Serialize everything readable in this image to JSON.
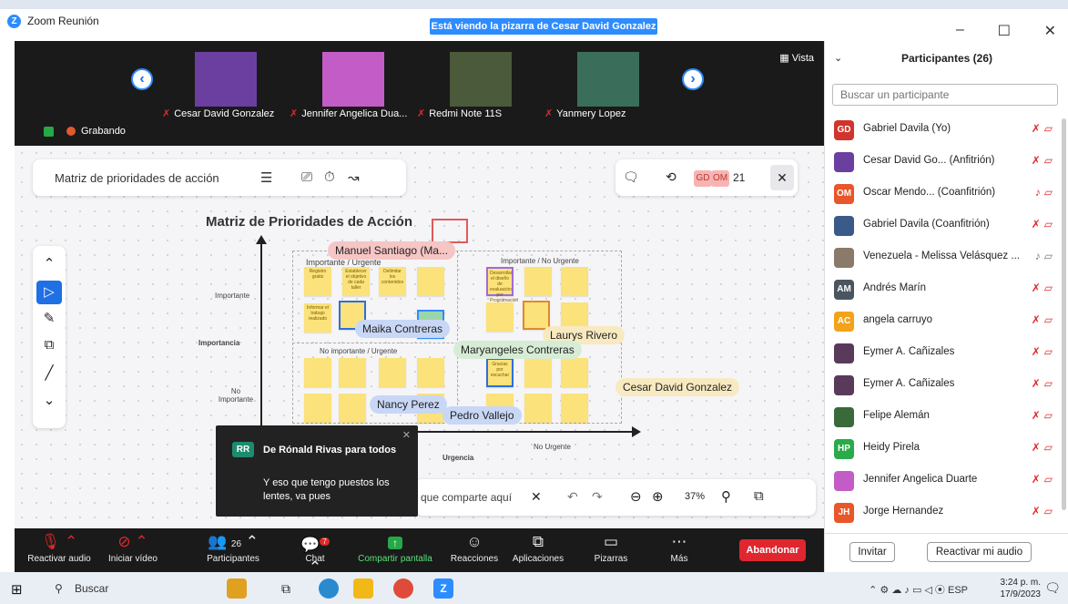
{
  "window": {
    "app_title": "Zoom Reunión",
    "share_banner": "Está viendo la pizarra de Cesar David Gonzalez",
    "view_label": "Vista"
  },
  "videos": [
    {
      "name": "Cesar David Gonzalez",
      "color": "#6b3fa0"
    },
    {
      "name": "Jennifer Angelica Dua...",
      "color": "#c45cc8"
    },
    {
      "name": "Redmi Note 11S",
      "color": "#4a5a3a"
    },
    {
      "name": "Yanmery Lopez",
      "color": "#3a6e5a"
    }
  ],
  "recording_label": "Grabando",
  "whiteboard": {
    "name": "Matriz de prioridades de acción",
    "avatars": [
      "GD",
      "OM"
    ],
    "count": "21",
    "zoom_level": "37%",
    "bottom_text": "que comparte aquí",
    "matrix": {
      "title": "Matriz de Prioridades de Acción",
      "q1": "Importante / Urgente",
      "q2": "Importante / No Urgente",
      "q3": "No importante / Urgente",
      "q4": "No Urgente",
      "y_axis": "Importancia",
      "y_high": "Importante",
      "y_low": "No Importante",
      "x_axis": "Urgencia",
      "notes_q1": [
        "Registro gratis",
        "Establecer el objetivo de cada taller",
        "Delimitar los contenidos",
        "Informar el trabajo realizado"
      ],
      "notes_q2": [
        "Desarrollar el diseño de evaluación por Programación"
      ],
      "notes_q4": [
        "Gracias por escuchar"
      ]
    },
    "cursors": [
      {
        "name": "Manuel Santiago (Ma...",
        "color": "#f6c5c5"
      },
      {
        "name": "Maika Contreras",
        "color": "#c8d7f5"
      },
      {
        "name": "Laurys Rivero",
        "color": "#f8eac0"
      },
      {
        "name": "Maryangeles Contreras",
        "color": "#d6ecd5"
      },
      {
        "name": "Cesar David Gonzalez",
        "color": "#f8eac0"
      },
      {
        "name": "Nancy Perez",
        "color": "#c8d7f5"
      },
      {
        "name": "Pedro Vallejo",
        "color": "#c8d7f5"
      }
    ]
  },
  "chat_popup": {
    "avatar": "RR",
    "from": "De Rónald Rivas para todos",
    "message": "Y eso que tengo puestos los lentes, va pues"
  },
  "toolbar": {
    "items": [
      "Reactivar audio",
      "Iniciar vídeo",
      "Participantes",
      "Chat",
      "Compartir pantalla",
      "Reacciones",
      "Aplicaciones",
      "Pizarras",
      "Más"
    ],
    "participants_count": "26",
    "chat_badge": "7",
    "leave": "Abandonar"
  },
  "participants_panel": {
    "title": "Participantes (26)",
    "search_placeholder": "Buscar un participante",
    "list": [
      {
        "initials": "GD",
        "name": "Gabriel Davila (Yo)",
        "color": "#d0342c"
      },
      {
        "initials": "",
        "name": "Cesar David Go...  (Anfitrión)",
        "color": "#6b3fa0"
      },
      {
        "initials": "OM",
        "name": "Oscar Mendo... (Coanfitrión)",
        "color": "#e8562a"
      },
      {
        "initials": "",
        "name": "Gabriel Davila (Coanfitrión)",
        "color": "#3a5a8a"
      },
      {
        "initials": "",
        "name": "Venezuela - Melissa Velásquez ...",
        "color": "#8a7a6a"
      },
      {
        "initials": "AM",
        "name": "Andrés Marín",
        "color": "#4a5560"
      },
      {
        "initials": "AC",
        "name": "angela carruyo",
        "color": "#f2a31b"
      },
      {
        "initials": "",
        "name": "Eymer A. Cañizales",
        "color": "#5a3a5a"
      },
      {
        "initials": "",
        "name": "Eymer A. Cañizales",
        "color": "#5a3a5a"
      },
      {
        "initials": "",
        "name": "Felipe Alemán",
        "color": "#3a6a3a"
      },
      {
        "initials": "HP",
        "name": "Heidy Pirela",
        "color": "#2aaa4a"
      },
      {
        "initials": "",
        "name": "Jennifer Angelica Duarte",
        "color": "#c45cc8"
      },
      {
        "initials": "JH",
        "name": "Jorge Hernandez",
        "color": "#e8562a"
      }
    ],
    "invite": "Invitar",
    "unmute": "Reactivar mi audio"
  },
  "taskbar": {
    "search": "Buscar",
    "time": "3:24 p. m.",
    "date": "17/9/2023",
    "lang": "ESP"
  }
}
